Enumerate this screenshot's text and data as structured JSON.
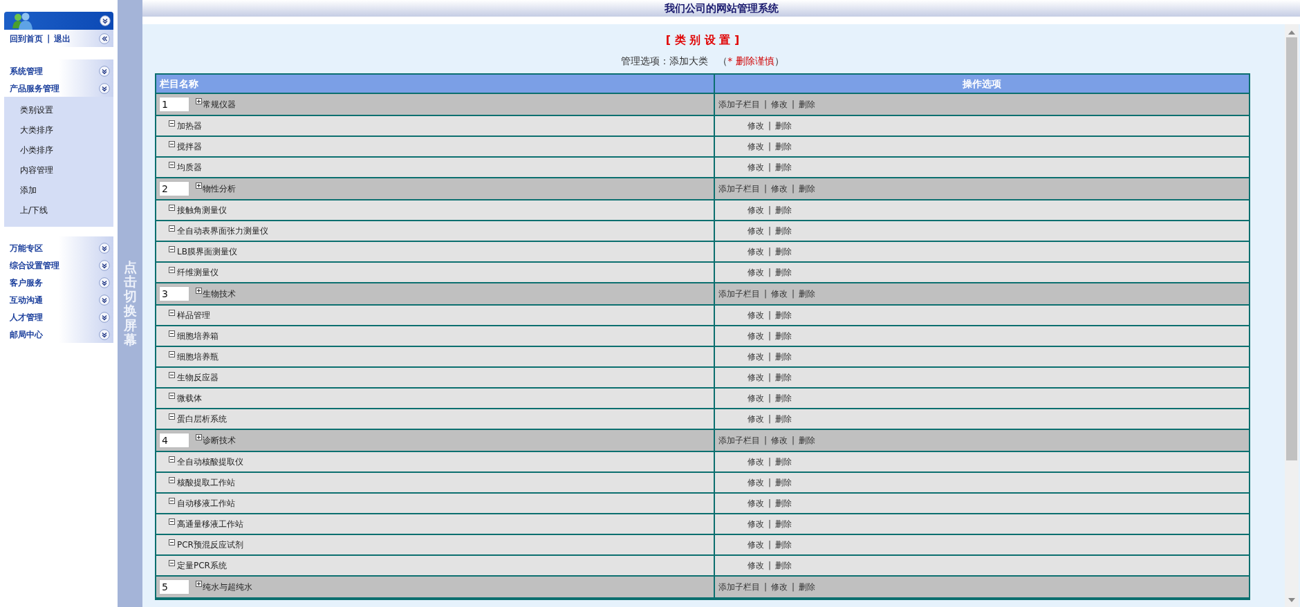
{
  "header": {
    "title": "我们公司的网站管理系统"
  },
  "sidebar": {
    "links": [
      "回到首页",
      "退出"
    ],
    "link_separator": "|",
    "sections": [
      {
        "groups": [
          {
            "label": "系统管理"
          },
          {
            "label": "产品服务管理",
            "children": [
              "类别设置",
              "大类排序",
              "小类排序",
              "内容管理",
              "添加",
              "上/下线"
            ]
          }
        ]
      },
      {
        "groups": [
          {
            "label": "万能专区"
          },
          {
            "label": "综合设置管理"
          },
          {
            "label": "客户服务"
          },
          {
            "label": "互动沟通"
          },
          {
            "label": "人才管理"
          },
          {
            "label": "邮局中心"
          }
        ]
      }
    ]
  },
  "toggle_bar": {
    "label": "点击切换屏幕"
  },
  "page": {
    "title": "[ 类 别 设 置 ]",
    "options_label": "管理选项：",
    "options_link": "添加大类",
    "caution_open": "（",
    "caution": "* 删除谨慎",
    "caution_close": "）"
  },
  "table": {
    "columns": [
      "栏目名称",
      "操作选项"
    ],
    "action_separator": "|",
    "categories": [
      {
        "order": "1",
        "name": "常规仪器",
        "actions": [
          "添加子栏目",
          "修改",
          "删除"
        ],
        "children": [
          {
            "name": "加热器",
            "actions": [
              "修改",
              "删除"
            ]
          },
          {
            "name": "搅拌器",
            "actions": [
              "修改",
              "删除"
            ]
          },
          {
            "name": "均质器",
            "actions": [
              "修改",
              "删除"
            ]
          }
        ]
      },
      {
        "order": "2",
        "name": "物性分析",
        "actions": [
          "添加子栏目",
          "修改",
          "删除"
        ],
        "children": [
          {
            "name": "接触角测量仪",
            "actions": [
              "修改",
              "删除"
            ]
          },
          {
            "name": "全自动表界面张力测量仪",
            "actions": [
              "修改",
              "删除"
            ]
          },
          {
            "name": "LB膜界面测量仪",
            "actions": [
              "修改",
              "删除"
            ]
          },
          {
            "name": "纤维测量仪",
            "actions": [
              "修改",
              "删除"
            ]
          }
        ]
      },
      {
        "order": "3",
        "name": "生物技术",
        "actions": [
          "添加子栏目",
          "修改",
          "删除"
        ],
        "children": [
          {
            "name": "样品管理",
            "actions": [
              "修改",
              "删除"
            ]
          },
          {
            "name": "细胞培养箱",
            "actions": [
              "修改",
              "删除"
            ]
          },
          {
            "name": "细胞培养瓶",
            "actions": [
              "修改",
              "删除"
            ]
          },
          {
            "name": "生物反应器",
            "actions": [
              "修改",
              "删除"
            ]
          },
          {
            "name": "微载体",
            "actions": [
              "修改",
              "删除"
            ]
          },
          {
            "name": "蛋白层析系统",
            "actions": [
              "修改",
              "删除"
            ]
          }
        ]
      },
      {
        "order": "4",
        "name": "诊断技术",
        "actions": [
          "添加子栏目",
          "修改",
          "删除"
        ],
        "children": [
          {
            "name": "全自动核酸提取仪",
            "actions": [
              "修改",
              "删除"
            ]
          },
          {
            "name": "核酸提取工作站",
            "actions": [
              "修改",
              "删除"
            ]
          },
          {
            "name": "自动移液工作站",
            "actions": [
              "修改",
              "删除"
            ]
          },
          {
            "name": "高通量移液工作站",
            "actions": [
              "修改",
              "删除"
            ]
          },
          {
            "name": "PCR预混反应试剂",
            "actions": [
              "修改",
              "删除"
            ]
          },
          {
            "name": "定量PCR系统",
            "actions": [
              "修改",
              "删除"
            ]
          }
        ]
      },
      {
        "order": "5",
        "name": "纯水与超纯水",
        "actions": [
          "添加子栏目",
          "修改",
          "删除"
        ]
      }
    ]
  }
}
